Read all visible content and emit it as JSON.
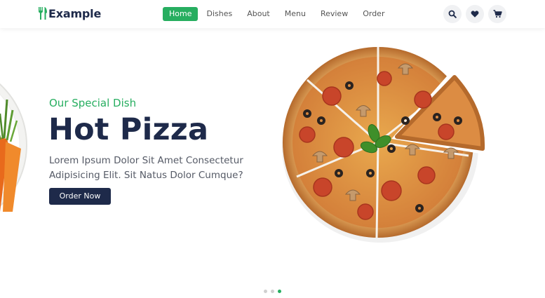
{
  "brand": {
    "name": "Example"
  },
  "nav": {
    "items": [
      {
        "label": "Home",
        "active": true
      },
      {
        "label": "Dishes",
        "active": false
      },
      {
        "label": "About",
        "active": false
      },
      {
        "label": "Menu",
        "active": false
      },
      {
        "label": "Review",
        "active": false
      },
      {
        "label": "Order",
        "active": false
      }
    ]
  },
  "header_icons": [
    "search-icon",
    "heart-icon",
    "cart-icon"
  ],
  "hero": {
    "subtitle": "Our Special Dish",
    "title": "Hot Pizza",
    "description": "Lorem Ipsum Dolor Sit Amet Consectetur Adipisicing Elit. Sit Natus Dolor Cumque?",
    "button_label": "Order Now"
  },
  "slider": {
    "count": 3,
    "active_index": 2
  },
  "colors": {
    "accent": "#27ae60",
    "navy": "#1e2a4a",
    "text_muted": "#555a66",
    "icon_bg": "#f0f1f3"
  }
}
